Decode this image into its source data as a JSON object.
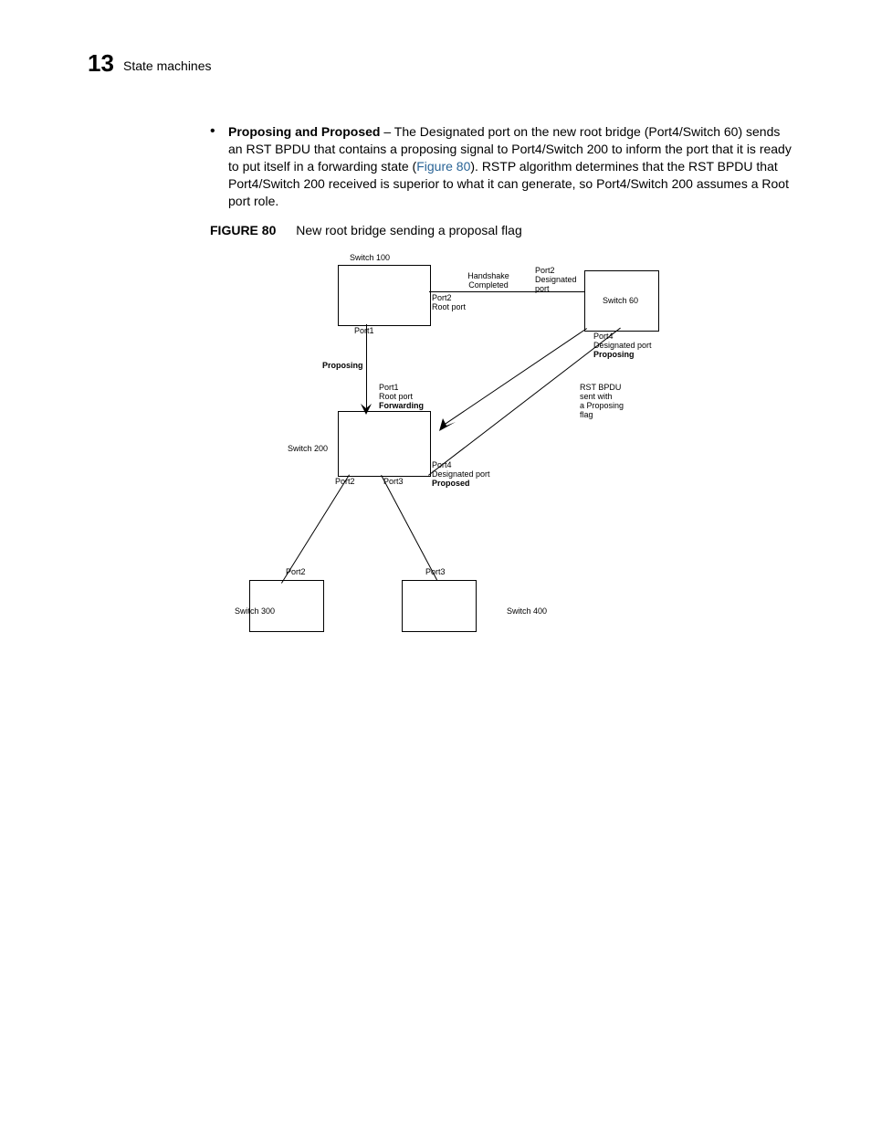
{
  "header": {
    "chapter_num": "13",
    "section": "State machines"
  },
  "body": {
    "term": "Proposing and Proposed",
    "text_before_link": " – The Designated port on the new root bridge (Port4/Switch 60) sends an RST BPDU that contains a proposing signal to Port4/Switch 200 to inform the port that it is ready to put itself in a forwarding state (",
    "link": "Figure 80",
    "text_after_link": "). RSTP algorithm determines that the RST BPDU that Port4/Switch 200 received is superior to what it can generate, so Port4/Switch 200 assumes a Root port role."
  },
  "figure": {
    "label": "FIGURE 80",
    "caption": "New root bridge sending a proposal flag",
    "diagram": {
      "switch100": "Switch 100",
      "switch60": "Switch 60",
      "switch200": "Switch 200",
      "switch300": "Switch 300",
      "switch400": "Switch 400",
      "sw100_port1": "Port1",
      "sw100_port2_1": "Port2",
      "sw100_port2_2": "Root port",
      "handshake_1": "Handshake",
      "handshake_2": "Completed",
      "sw60_port2_1": "Port2",
      "sw60_port2_2": "Designated",
      "sw60_port2_3": "port",
      "sw60_port4_1": "Port4",
      "sw60_port4_2": "Designated port",
      "sw60_port4_3": "Proposing",
      "sw200_port1_top_1": "Port1",
      "sw200_port1_top_2": "Root port",
      "sw200_port1_top_3": "Forwarding",
      "sw200_port4_1": "Port4",
      "sw200_port4_2": "Designated port",
      "sw200_port4_3": "Proposed",
      "sw200_port2": "Port2",
      "sw200_port3": "Port3",
      "sw300_port2": "Port2",
      "sw400_port3": "Port3",
      "proposing_label": "Proposing",
      "rst_1": "RST BPDU",
      "rst_2": "sent with",
      "rst_3": "a Proposing",
      "rst_4": "flag"
    }
  }
}
